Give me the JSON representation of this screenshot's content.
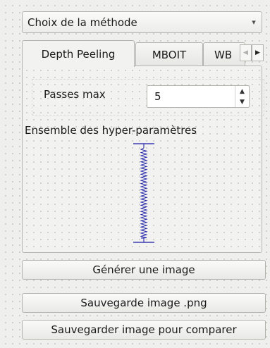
{
  "method_combo": {
    "selected": "Choix de la méthode",
    "arrow_icon": "▾"
  },
  "tabs": [
    {
      "label": "Depth Peeling",
      "active": true
    },
    {
      "label": "MBOIT",
      "active": false
    },
    {
      "label": "WB",
      "active": false
    }
  ],
  "tab_scroll": {
    "left_icon": "◀",
    "right_icon": "▶"
  },
  "depth_peeling": {
    "passes_label": "Passes max",
    "passes_value": "5",
    "hyper_label": "Ensemble des hyper-paramètres"
  },
  "spin": {
    "up_icon": "▲",
    "down_icon": "▼"
  },
  "buttons": {
    "generate": "Générer une image",
    "save_png": "Sauvegarde image .png",
    "save_compare": "Sauvegarder image pour comparer"
  },
  "colors": {
    "spring": "#1a1aa6",
    "background": "#efefee"
  }
}
